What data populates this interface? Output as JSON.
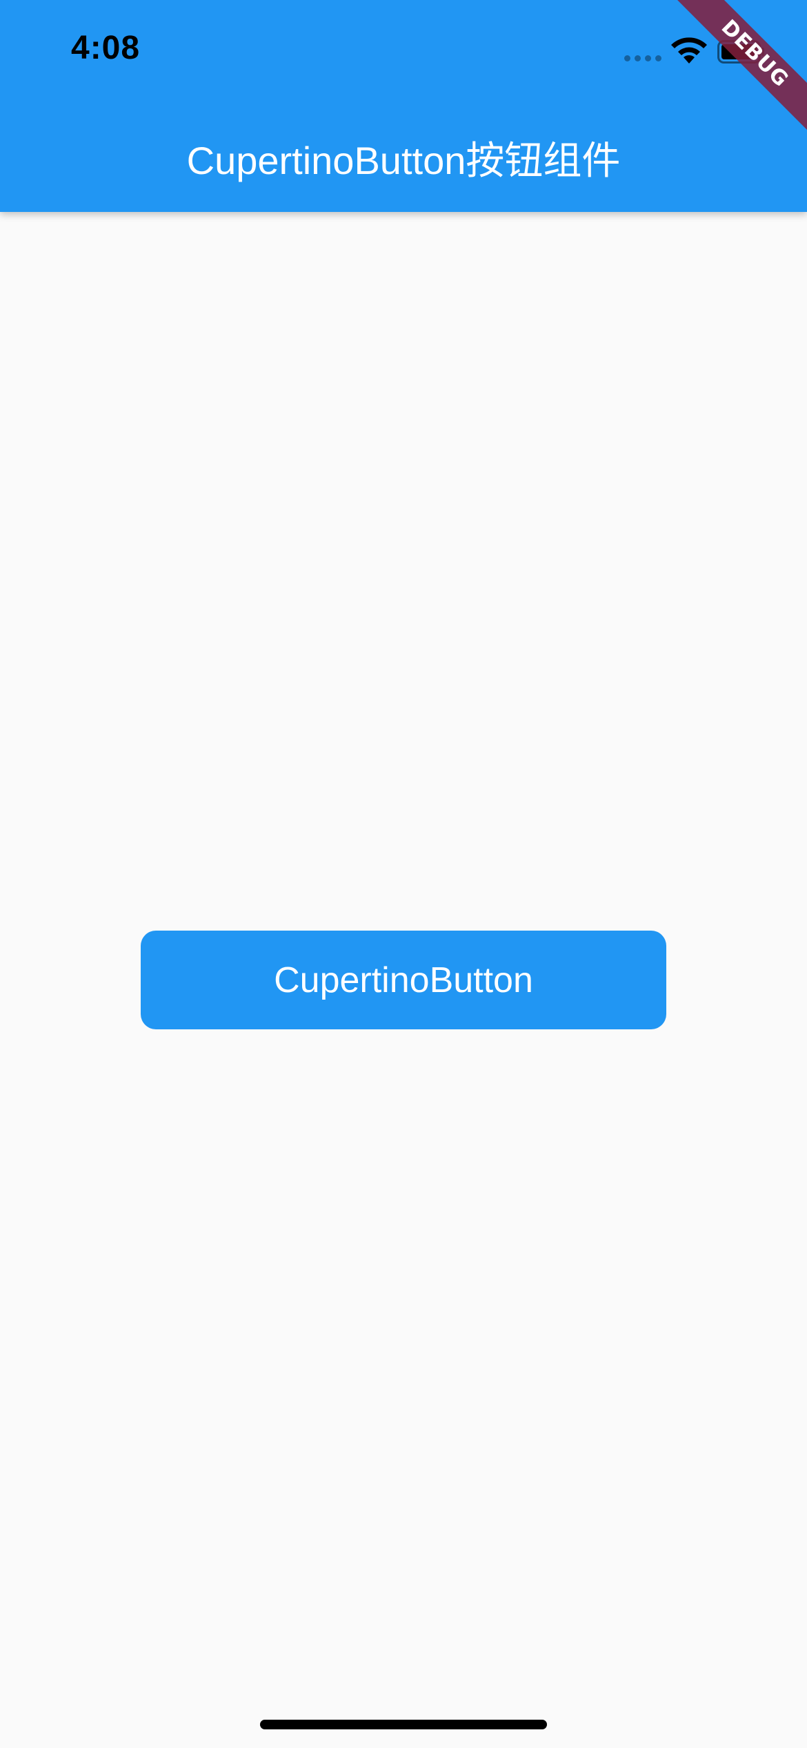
{
  "status_bar": {
    "time": "4:08",
    "icons": [
      "signal-icon",
      "wifi-icon",
      "battery-icon"
    ]
  },
  "app_bar": {
    "title": "CupertinoButton按钮组件",
    "background_color": "#2196f3"
  },
  "debug_banner": {
    "label": "DEBUG"
  },
  "main": {
    "button_label": "CupertinoButton",
    "button_color": "#2196f3"
  }
}
